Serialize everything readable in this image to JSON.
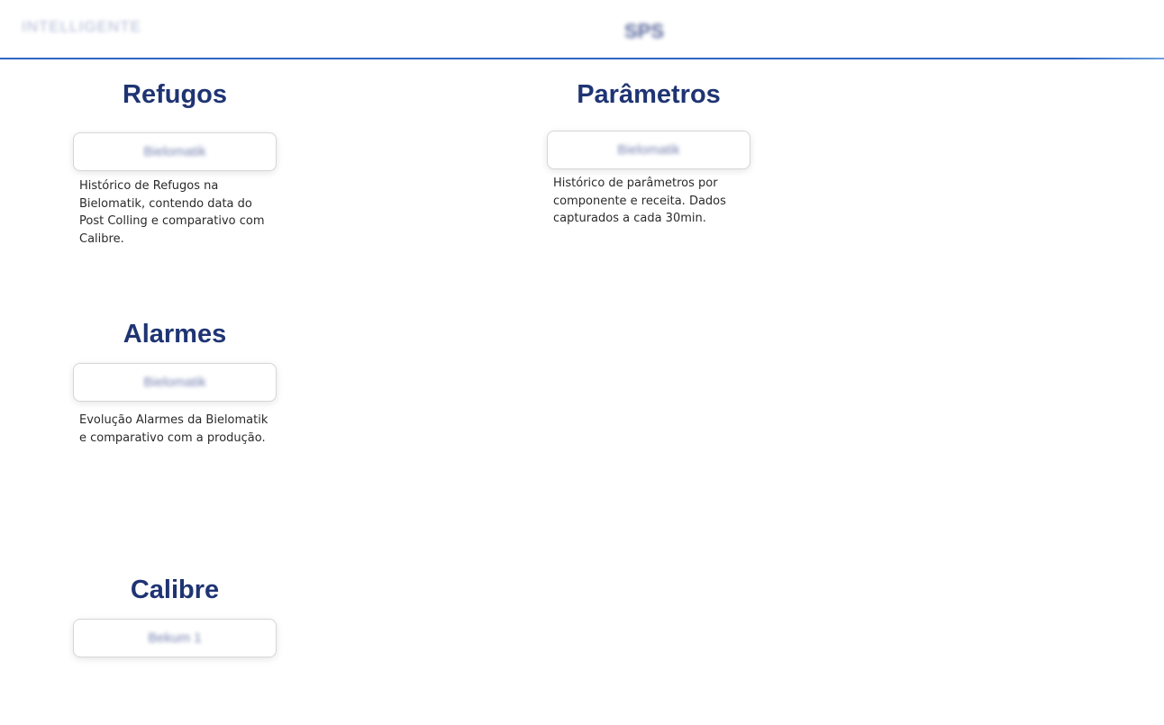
{
  "header": {
    "logo_text": "INTELLIGENTE",
    "title": "SPS"
  },
  "sections": {
    "refugos": {
      "title": "Refugos",
      "button_label": "Bielomatik",
      "description": "Histórico de Refugos na Bielomatik, contendo data do Post Colling e comparativo com Calibre."
    },
    "parametros": {
      "title": "Parâmetros",
      "button_label": "Bielomatik",
      "description": "Histórico de parâmetros por componente e receita. Dados capturados a cada 30min."
    },
    "alarmes": {
      "title": "Alarmes",
      "button_label": "Bielomatik",
      "description": "Evolução Alarmes da Bielomatik e comparativo com a produção."
    },
    "calibre": {
      "title": "Calibre",
      "button_label": "Bekum 1"
    }
  },
  "colors": {
    "title": "#1f3473",
    "accent_line": "#2e66c2",
    "text": "#2a2a2a"
  }
}
